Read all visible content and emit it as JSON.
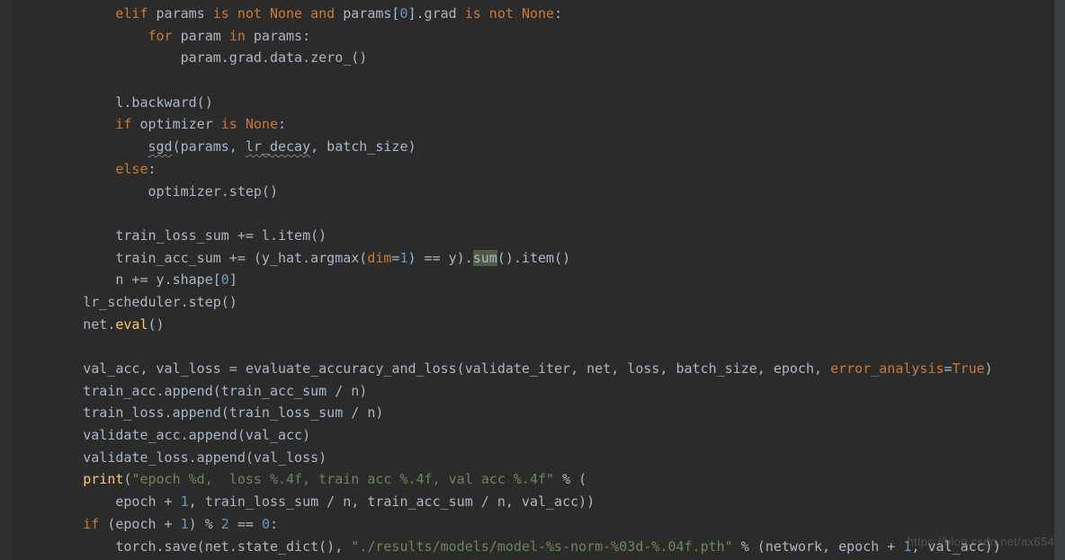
{
  "gutter": [
    "",
    "",
    "",
    "",
    "",
    "",
    "",
    "",
    "",
    "",
    "",
    "",
    "",
    "",
    "",
    "",
    "",
    "",
    "",
    "",
    "",
    "",
    "",
    "",
    ""
  ],
  "code": {
    "tokens": [
      [
        [
          "            ",
          "pl"
        ],
        [
          "elif ",
          "kw"
        ],
        [
          "params ",
          "pl"
        ],
        [
          "is not ",
          "kw"
        ],
        [
          "None ",
          "kw"
        ],
        [
          "and ",
          "kw"
        ],
        [
          "params[",
          "pl"
        ],
        [
          "0",
          "num"
        ],
        [
          "].grad ",
          "pl"
        ],
        [
          "is not ",
          "kw"
        ],
        [
          "None",
          "kw"
        ],
        [
          ":",
          "pl"
        ]
      ],
      [
        [
          "                ",
          "pl"
        ],
        [
          "for ",
          "kw"
        ],
        [
          "param ",
          "pl"
        ],
        [
          "in ",
          "kw"
        ],
        [
          "params:",
          "pl"
        ]
      ],
      [
        [
          "                    param.grad.data.zero_()",
          "pl"
        ]
      ],
      [
        [
          "",
          "pl"
        ]
      ],
      [
        [
          "            l.backward()",
          "pl"
        ]
      ],
      [
        [
          "            ",
          "pl"
        ],
        [
          "if ",
          "kw"
        ],
        [
          "optimizer ",
          "pl"
        ],
        [
          "is ",
          "kw"
        ],
        [
          "None",
          "kw"
        ],
        [
          ":",
          "pl"
        ]
      ],
      [
        [
          "                ",
          "pl"
        ],
        [
          "sgd",
          "ul"
        ],
        [
          "(params, ",
          "pl"
        ],
        [
          "lr_decay",
          "ul"
        ],
        [
          ", batch_size)",
          "pl"
        ]
      ],
      [
        [
          "            ",
          "pl"
        ],
        [
          "else",
          "kw"
        ],
        [
          ":",
          "pl"
        ]
      ],
      [
        [
          "                optimizer.step()",
          "pl"
        ]
      ],
      [
        [
          "",
          "pl"
        ]
      ],
      [
        [
          "            train_loss_sum += l.item()",
          "pl"
        ]
      ],
      [
        [
          "            train_acc_sum += (y_hat.argmax(",
          "pl"
        ],
        [
          "dim",
          "kw"
        ],
        [
          "=",
          "pl"
        ],
        [
          "1",
          "num"
        ],
        [
          ") == y).",
          "pl"
        ],
        [
          "sum",
          "hl"
        ],
        [
          "().item()",
          "pl"
        ]
      ],
      [
        [
          "            n += y.shape[",
          "pl"
        ],
        [
          "0",
          "num"
        ],
        [
          "]",
          "pl"
        ]
      ],
      [
        [
          "        lr_scheduler.step()",
          "pl"
        ]
      ],
      [
        [
          "        net.",
          "pl"
        ],
        [
          "eval",
          "fn"
        ],
        [
          "()",
          "pl"
        ]
      ],
      [
        [
          "",
          "pl"
        ]
      ],
      [
        [
          "        val_acc, val_loss = evaluate_accuracy_and_loss(validate_iter, net, loss, batch_size, epoch, ",
          "pl"
        ],
        [
          "error_analysis",
          "kw"
        ],
        [
          "=",
          "pl"
        ],
        [
          "True",
          "kw"
        ],
        [
          ")",
          "pl"
        ]
      ],
      [
        [
          "        train_acc.append(train_acc_sum / n)",
          "pl"
        ]
      ],
      [
        [
          "        train_loss.append(train_loss_sum / n)",
          "pl"
        ]
      ],
      [
        [
          "        validate_acc.append(val_acc)",
          "pl"
        ]
      ],
      [
        [
          "        validate_loss.append(val_loss)",
          "pl"
        ]
      ],
      [
        [
          "        ",
          "pl"
        ],
        [
          "print",
          "fn"
        ],
        [
          "(",
          "pl"
        ],
        [
          "\"epoch %d,  loss %.4f, train acc %.4f, val acc %.4f\" ",
          "str"
        ],
        [
          "% (",
          "pl"
        ]
      ],
      [
        [
          "            epoch + ",
          "pl"
        ],
        [
          "1",
          "num"
        ],
        [
          ", train_loss_sum / n, train_acc_sum / n, val_acc))",
          "pl"
        ]
      ],
      [
        [
          "        ",
          "pl"
        ],
        [
          "if ",
          "kw"
        ],
        [
          "(epoch + ",
          "pl"
        ],
        [
          "1",
          "num"
        ],
        [
          ") % ",
          "pl"
        ],
        [
          "2 ",
          "num"
        ],
        [
          "== ",
          "pl"
        ],
        [
          "0",
          "num"
        ],
        [
          ":",
          "pl"
        ]
      ],
      [
        [
          "            torch.save(net.state_dict(), ",
          "pl"
        ],
        [
          "\"./results/models/model-%s-norm-%03d-%.04f.pth\" ",
          "str"
        ],
        [
          "% (network, epoch + ",
          "pl"
        ],
        [
          "1",
          "num"
        ],
        [
          ", val_acc))",
          "pl"
        ]
      ]
    ]
  },
  "watermark": "https://blog.csdn.net/ax654"
}
